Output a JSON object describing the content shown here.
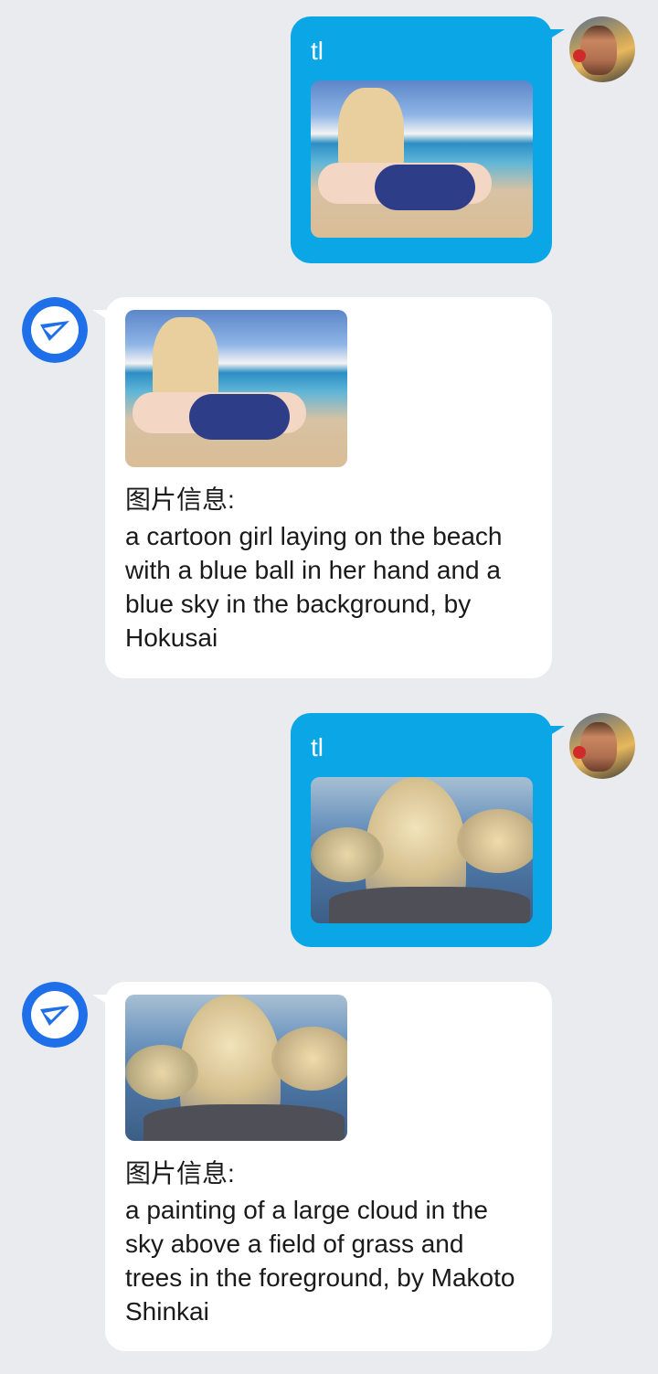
{
  "messages": [
    {
      "sender": "user",
      "text": "tl",
      "image_icon": "anime-beach-image"
    },
    {
      "sender": "bot",
      "image_icon": "anime-beach-image",
      "info_label": "图片信息:",
      "caption": "a cartoon girl laying on the beach with a blue ball in her hand and a blue sky in the background, by Hokusai"
    },
    {
      "sender": "user",
      "text": "tl",
      "image_icon": "cloud-painting-image"
    },
    {
      "sender": "bot",
      "image_icon": "cloud-painting-image",
      "info_label": "图片信息:",
      "caption": "a painting of a large cloud in the sky above a field of grass and trees in the foreground, by Makoto Shinkai"
    }
  ],
  "colors": {
    "background": "#eaebef",
    "user_bubble": "#0aa6e6",
    "bot_bubble": "#ffffff",
    "bot_logo": "#1f6fe8"
  },
  "icons": {
    "user_avatar": "user-avatar",
    "bot_avatar": "bot-logo-icon"
  }
}
